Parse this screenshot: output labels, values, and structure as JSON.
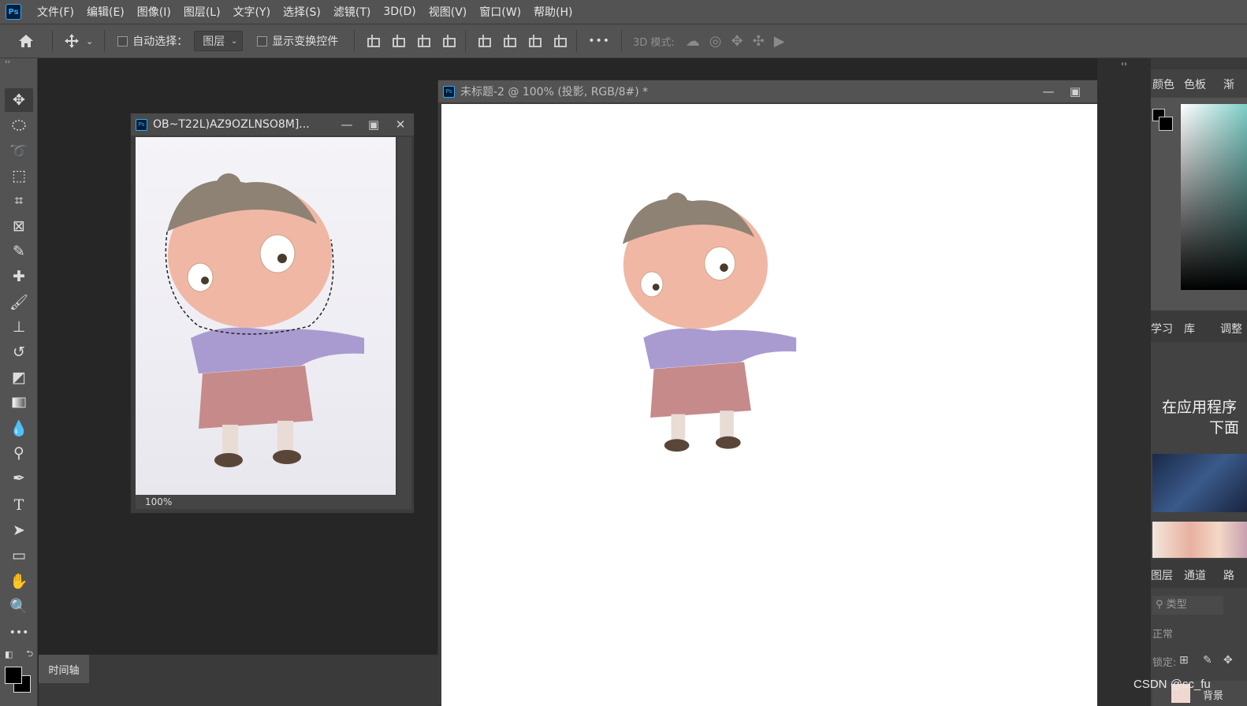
{
  "menu": {
    "logo": "Ps",
    "items": [
      "文件(F)",
      "编辑(E)",
      "图像(I)",
      "图层(L)",
      "文字(Y)",
      "选择(S)",
      "滤镜(T)",
      "3D(D)",
      "视图(V)",
      "窗口(W)",
      "帮助(H)"
    ]
  },
  "options": {
    "auto_select_label": "自动选择：",
    "layer_select_value": "图层",
    "show_transform_label": "显示变换控件",
    "mode_3d_label": "3D 模式:",
    "more": "•••"
  },
  "toolbar": {
    "collapse": "››",
    "more": "•••"
  },
  "doc_small": {
    "title": "OB~T22L)AZ9OZLNSO8M]...",
    "zoom": "100%"
  },
  "doc_main": {
    "title": "未标题-2 @ 100% (投影, RGB/8#) *"
  },
  "timeline": {
    "tab": "时间轴"
  },
  "right_panels": {
    "collapse": "‹‹",
    "color_tabs": [
      "颜色",
      "色板",
      "渐"
    ],
    "learn_tabs": [
      "学习",
      "库",
      "调整"
    ],
    "learn_heading_line1": "在应用程序",
    "learn_heading_line2": "下面",
    "layers_tabs": [
      "图层",
      "通道",
      "路"
    ],
    "layers_search_placeholder": "类型",
    "blend_mode": "正常",
    "lock_label": "锁定:",
    "layer_name": "背景"
  },
  "watermark": "CSDN @cc_fu",
  "colors": {
    "chrome": "#535353",
    "canvas_bg": "#262626",
    "ps_blue": "#31a8ff",
    "canvas": "#ffffff"
  }
}
